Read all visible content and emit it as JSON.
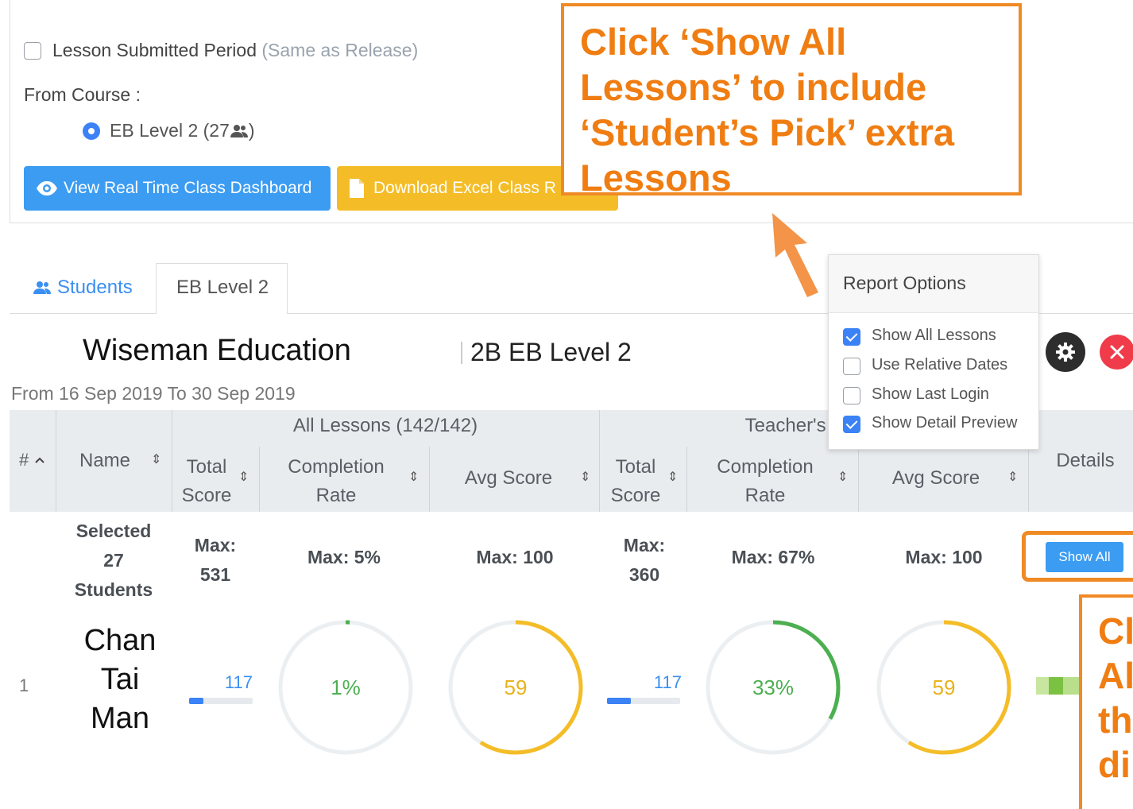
{
  "filters": {
    "submitted_label": "Lesson Submitted Period",
    "submitted_note": "(Same as Release)",
    "from_course_label": "From Course :",
    "course_option": "EB Level 2 (27",
    "course_option_suffix": ")"
  },
  "buttons": {
    "dashboard": "View Real Time Class Dashboard",
    "excel": "Download Excel Class R"
  },
  "callout_top": {
    "line1": "Click ‘Show All",
    "line2": "Lessons’ to include",
    "line3": "‘Student’s Pick’ extra",
    "line4": "Lessons"
  },
  "callout_right": {
    "line1": "Cl",
    "line2": "Al",
    "line3": "th",
    "line4": "di"
  },
  "tabs": {
    "students": "Students",
    "level": "EB Level 2"
  },
  "report": {
    "org": "Wiseman Education",
    "class": "2B EB Level 2",
    "date_range": "From 16 Sep 2019 To 30 Sep 2019"
  },
  "report_options": {
    "title": "Report Options",
    "items": [
      {
        "label": "Show All Lessons",
        "checked": true
      },
      {
        "label": "Use Relative Dates",
        "checked": false
      },
      {
        "label": "Show Last Login",
        "checked": false
      },
      {
        "label": "Show Detail Preview",
        "checked": true
      }
    ]
  },
  "table": {
    "group_all": "All Lessons (142/142)",
    "group_teacher": "Teacher's P",
    "col_num": "#",
    "col_name": "Name",
    "col_total_1": "Total",
    "col_total_2": "Score",
    "col_comp_1": "Completion",
    "col_comp_2": "Rate",
    "col_avg": "Avg Score",
    "col_details": "Details",
    "summary": {
      "selected_1": "Selected",
      "selected_2": "27",
      "selected_3": "Students",
      "all_total_label": "Max:",
      "all_total_value": "531",
      "all_comp": "Max: 5%",
      "all_avg": "Max: 100",
      "tp_total_label": "Max:",
      "tp_total_value": "360",
      "tp_comp": "Max: 67%",
      "tp_avg": "Max: 100",
      "show_all": "Show All"
    },
    "row": {
      "index": "1",
      "name_1": "Chan",
      "name_2": "Tai",
      "name_3": "Man",
      "all_total": "117",
      "all_total_fraction": 0.22,
      "all_comp": "1%",
      "all_comp_value": 1,
      "all_avg": "59",
      "all_avg_value": 59,
      "tp_total": "117",
      "tp_total_fraction": 0.33,
      "tp_comp": "33%",
      "tp_comp_value": 33,
      "tp_avg": "59",
      "tp_avg_value": 59
    }
  },
  "colors": {
    "accent_blue": "#3b82f6",
    "callout_orange": "#f07d12",
    "ring_green": "#4caf50",
    "ring_yellow": "#f4bd27",
    "close_red": "#ef3b4a"
  },
  "icons": [
    "eye-icon",
    "file-icon",
    "users-icon",
    "gear-icon",
    "close-icon",
    "arrow-up-icon",
    "sort-icon",
    "chevron-up-icon"
  ]
}
